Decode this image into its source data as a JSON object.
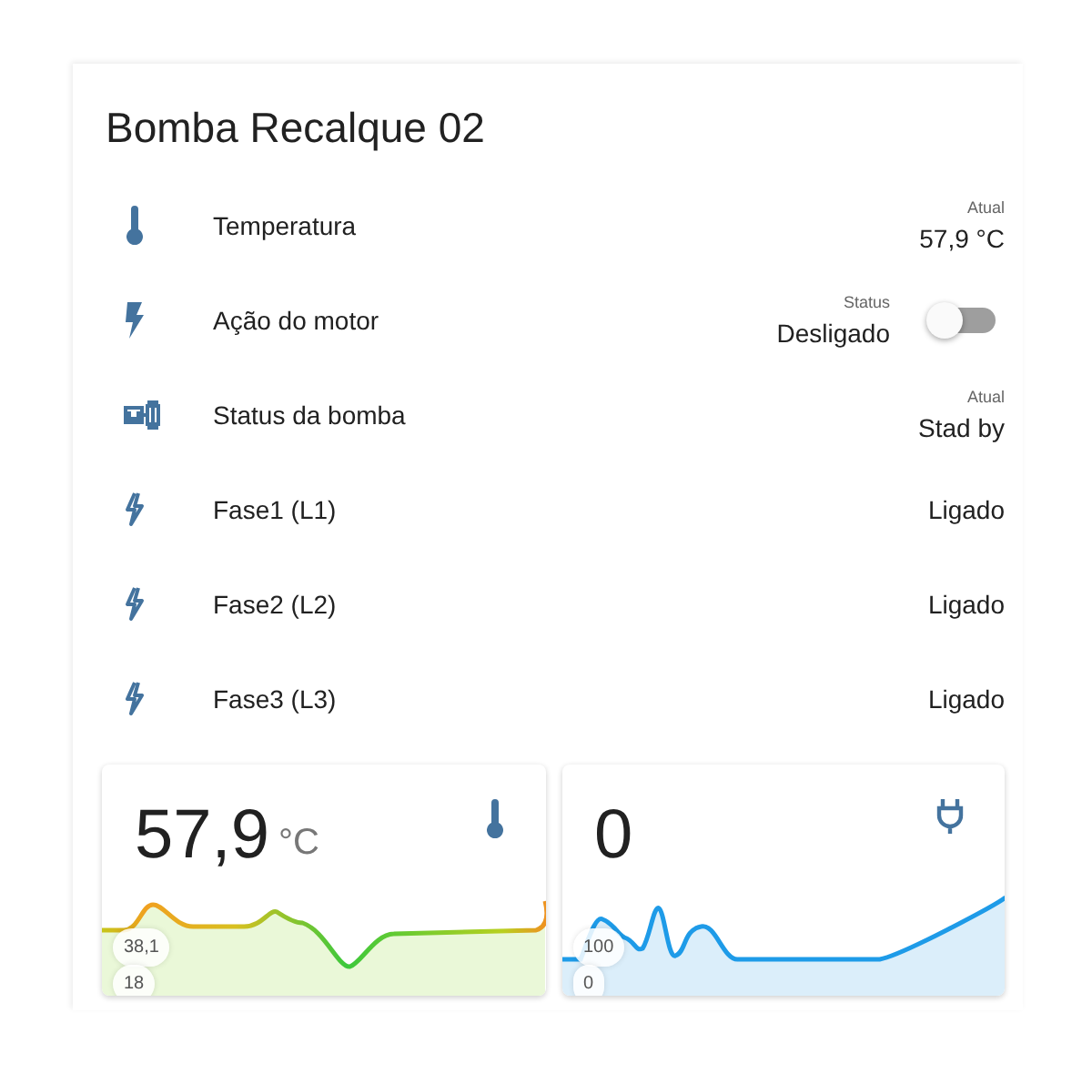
{
  "card": {
    "title": "Bomba Recalque 02"
  },
  "entities": [
    {
      "kind": "temperature",
      "name": "Temperatura",
      "caption": "Atual",
      "value": "57,9 °C"
    },
    {
      "kind": "switch",
      "name": "Ação do motor",
      "caption": "Status",
      "value": "Desligado",
      "on": false
    },
    {
      "kind": "status",
      "name": "Status da bomba",
      "caption": "Atual",
      "value": "Stad by"
    },
    {
      "kind": "phase",
      "name": "Fase1 (L1)",
      "value": "Ligado"
    },
    {
      "kind": "phase",
      "name": "Fase2 (L2)",
      "value": "Ligado"
    },
    {
      "kind": "phase",
      "name": "Fase3 (L3)",
      "value": "Ligado"
    }
  ],
  "sensor_cards": [
    {
      "kind": "temperature",
      "value": "57,9",
      "unit": "°C",
      "max_label": "38,1",
      "min_label": "18"
    },
    {
      "kind": "power",
      "value": "0",
      "max_label": "100",
      "min_label": "0"
    }
  ]
}
